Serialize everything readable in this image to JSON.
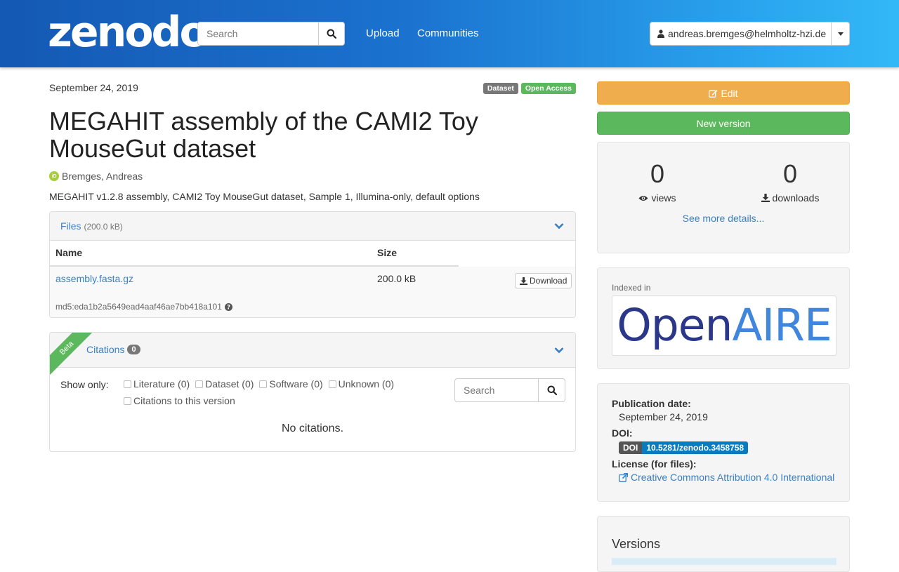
{
  "header": {
    "logo_text": "zenodo",
    "search_placeholder": "Search",
    "nav": [
      "Upload",
      "Communities"
    ],
    "user_email": "andreas.bremges@helmholtz-hzi.de"
  },
  "record": {
    "publication_date": "September 24, 2019",
    "labels": {
      "type": "Dataset",
      "access": "Open Access"
    },
    "title": "MEGAHIT assembly of the CAMI2 Toy MouseGut dataset",
    "creator": "Bremges, Andreas",
    "orcid_text": "iD",
    "description": "MEGAHIT v1.2.8 assembly, CAMI2 Toy MouseGut dataset, Sample 1, Illumina-only, default options"
  },
  "files": {
    "heading": "Files",
    "total_size": "(200.0 kB)",
    "columns": [
      "Name",
      "Size"
    ],
    "rows": [
      {
        "name": "assembly.fasta.gz",
        "size": "200.0 kB",
        "checksum": "md5:eda1b2a5649ead4aaf46ae7bb418a101",
        "download_label": "Download"
      }
    ]
  },
  "citations": {
    "ribbon": "Beta",
    "heading": "Citations",
    "count": "0",
    "show_only_label": "Show only:",
    "filters": [
      "Literature (0)",
      "Dataset (0)",
      "Software (0)",
      "Unknown (0)"
    ],
    "version_filter": "Citations to this version",
    "search_placeholder": "Search",
    "empty_message": "No citations."
  },
  "sidebar": {
    "edit_label": "Edit",
    "new_version_label": "New version",
    "stats": {
      "views": "0",
      "views_label": "views",
      "downloads": "0",
      "downloads_label": "downloads",
      "more_link": "See more details..."
    },
    "indexed_in_label": "Indexed in",
    "openaire_logo": {
      "part1": "Open",
      "part2": "AIRE",
      "color1": "#2b3788",
      "color2": "#3f86dc"
    },
    "info": {
      "pub_date_label": "Publication date:",
      "pub_date": "September 24, 2019",
      "doi_label": "DOI:",
      "doi_key": "DOI",
      "doi_value": "10.5281/zenodo.3458758",
      "license_label": "License (for files):",
      "license": "Creative Commons Attribution 4.0 International"
    },
    "versions_title": "Versions"
  },
  "colors": {
    "header_gradient_start": "#1459b3",
    "header_gradient_end": "#33b8f7",
    "link": "#3a7fc1",
    "edit_button": "#f0ad4e",
    "success": "#5cb85c"
  }
}
